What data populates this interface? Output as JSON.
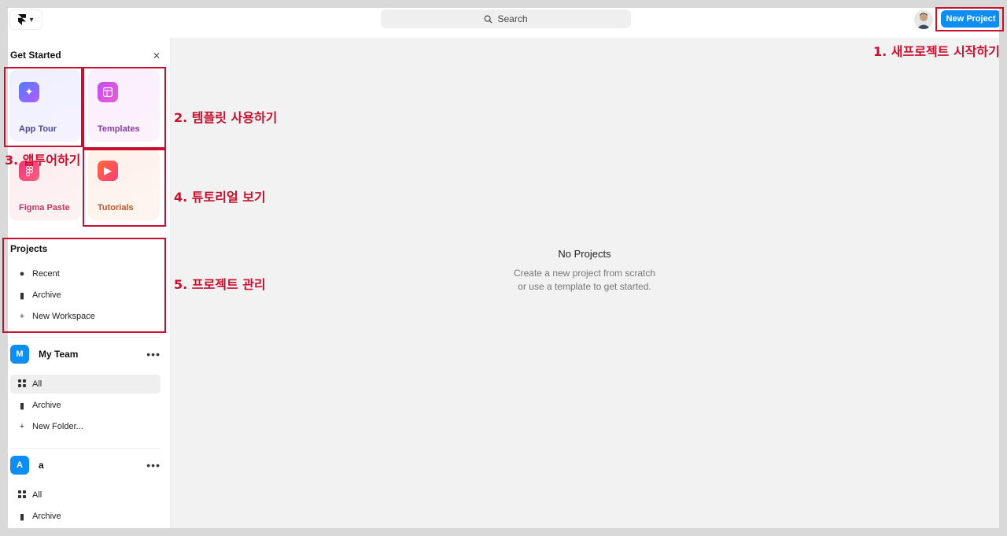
{
  "topbar": {
    "search_label": "Search",
    "new_project_label": "New Project"
  },
  "sidebar": {
    "get_started": {
      "title": "Get Started",
      "cards": [
        {
          "label": "App Tour"
        },
        {
          "label": "Templates"
        },
        {
          "label": "Figma Paste"
        },
        {
          "label": "Tutorials"
        }
      ]
    },
    "projects": {
      "title": "Projects",
      "items": [
        {
          "label": "Recent",
          "icon": "clock-icon"
        },
        {
          "label": "Archive",
          "icon": "trash-icon"
        },
        {
          "label": "New Workspace",
          "icon": "plus-icon"
        }
      ]
    },
    "teams": [
      {
        "badge": "M",
        "name": "My Team",
        "items": [
          {
            "label": "All",
            "icon": "grid-icon",
            "active": true
          },
          {
            "label": "Archive",
            "icon": "trash-icon"
          },
          {
            "label": "New Folder...",
            "icon": "plus-icon"
          }
        ]
      },
      {
        "badge": "A",
        "name": "a",
        "items": [
          {
            "label": "All",
            "icon": "grid-icon"
          },
          {
            "label": "Archive",
            "icon": "trash-icon"
          }
        ]
      }
    ]
  },
  "main": {
    "empty_title": "No Projects",
    "empty_line1": "Create a new project from scratch",
    "empty_line2": "or use a template to get started."
  },
  "annotations": {
    "a1": "1. 새프로젝트 시작하기",
    "a2": "2. 템플릿 사용하기",
    "a3": "3. 앱투어하기",
    "a4": "4. 튜토리얼 보기",
    "a5": "5. 프로젝트 관리"
  },
  "colors": {
    "accent": "#0e8ef2",
    "annotation": "#c8102e"
  }
}
